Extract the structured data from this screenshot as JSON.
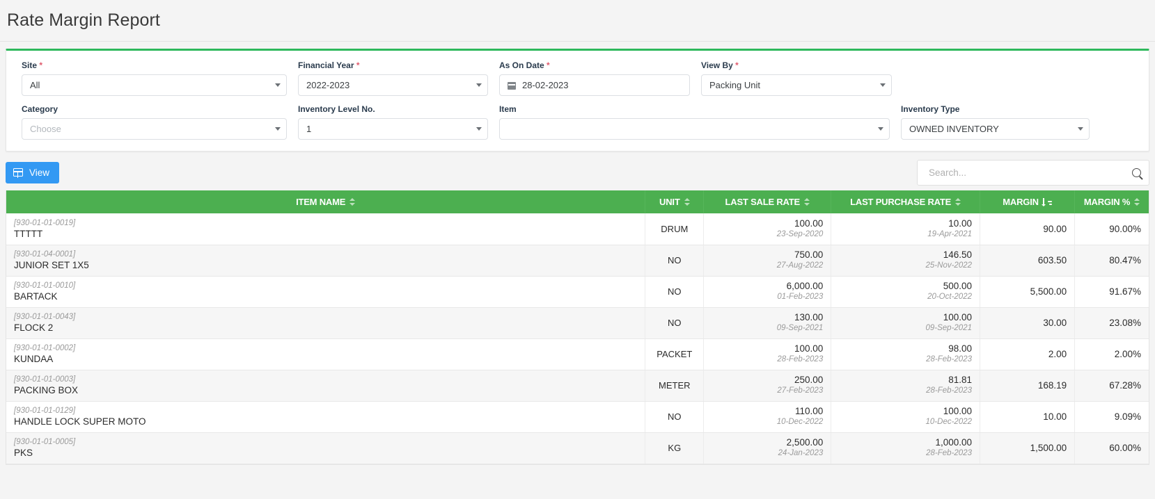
{
  "page": {
    "title": "Rate Margin Report"
  },
  "filters": {
    "site": {
      "label": "Site",
      "required": true,
      "value": "All",
      "placeholder": ""
    },
    "financial_year": {
      "label": "Financial Year",
      "required": true,
      "value": "2022-2023",
      "placeholder": ""
    },
    "as_on_date": {
      "label": "As On Date",
      "required": true,
      "value": "28-02-2023",
      "placeholder": "",
      "icon": "calendar-icon"
    },
    "view_by": {
      "label": "View By",
      "required": true,
      "value": "Packing Unit",
      "placeholder": ""
    },
    "category": {
      "label": "Category",
      "required": false,
      "value": "",
      "placeholder": "Choose"
    },
    "inventory_level": {
      "label": "Inventory Level No.",
      "required": false,
      "value": "1",
      "placeholder": ""
    },
    "item": {
      "label": "Item",
      "required": false,
      "value": "",
      "placeholder": ""
    },
    "inventory_type": {
      "label": "Inventory Type",
      "required": false,
      "value": "OWNED INVENTORY",
      "placeholder": ""
    }
  },
  "toolbar": {
    "view_label": "View",
    "view_icon": "grid-icon",
    "search_placeholder": "Search...",
    "search_value": "",
    "search_icon": "search-icon"
  },
  "table": {
    "columns": [
      {
        "key": "item",
        "label": "ITEM NAME",
        "sort": "sortable"
      },
      {
        "key": "unit",
        "label": "UNIT",
        "sort": "sortable"
      },
      {
        "key": "lsr",
        "label": "LAST SALE RATE",
        "sort": "sortable"
      },
      {
        "key": "lpr",
        "label": "LAST PURCHASE RATE",
        "sort": "sortable"
      },
      {
        "key": "mar",
        "label": "MARGIN",
        "sort": "active-desc"
      },
      {
        "key": "pct",
        "label": "MARGIN %",
        "sort": "sortable"
      }
    ],
    "rows": [
      {
        "code": "[930-01-01-0019]",
        "name": "TTTTT",
        "unit": "DRUM",
        "sale_rate": "100.00",
        "sale_date": "23-Sep-2020",
        "purchase_rate": "10.00",
        "purchase_date": "19-Apr-2021",
        "margin": "90.00",
        "margin_pct": "90.00%"
      },
      {
        "code": "[930-01-04-0001]",
        "name": "JUNIOR SET 1X5",
        "unit": "NO",
        "sale_rate": "750.00",
        "sale_date": "27-Aug-2022",
        "purchase_rate": "146.50",
        "purchase_date": "25-Nov-2022",
        "margin": "603.50",
        "margin_pct": "80.47%"
      },
      {
        "code": "[930-01-01-0010]",
        "name": "BARTACK",
        "unit": "NO",
        "sale_rate": "6,000.00",
        "sale_date": "01-Feb-2023",
        "purchase_rate": "500.00",
        "purchase_date": "20-Oct-2022",
        "margin": "5,500.00",
        "margin_pct": "91.67%"
      },
      {
        "code": "[930-01-01-0043]",
        "name": "FLOCK 2",
        "unit": "NO",
        "sale_rate": "130.00",
        "sale_date": "09-Sep-2021",
        "purchase_rate": "100.00",
        "purchase_date": "09-Sep-2021",
        "margin": "30.00",
        "margin_pct": "23.08%"
      },
      {
        "code": "[930-01-01-0002]",
        "name": "KUNDAA",
        "unit": "PACKET",
        "sale_rate": "100.00",
        "sale_date": "28-Feb-2023",
        "purchase_rate": "98.00",
        "purchase_date": "28-Feb-2023",
        "margin": "2.00",
        "margin_pct": "2.00%"
      },
      {
        "code": "[930-01-01-0003]",
        "name": "PACKING BOX",
        "unit": "METER",
        "sale_rate": "250.00",
        "sale_date": "27-Feb-2023",
        "purchase_rate": "81.81",
        "purchase_date": "28-Feb-2023",
        "margin": "168.19",
        "margin_pct": "67.28%"
      },
      {
        "code": "[930-01-01-0129]",
        "name": "HANDLE LOCK SUPER MOTO",
        "unit": "NO",
        "sale_rate": "110.00",
        "sale_date": "10-Dec-2022",
        "purchase_rate": "100.00",
        "purchase_date": "10-Dec-2022",
        "margin": "10.00",
        "margin_pct": "9.09%"
      },
      {
        "code": "[930-01-01-0005]",
        "name": "PKS",
        "unit": "KG",
        "sale_rate": "2,500.00",
        "sale_date": "24-Jan-2023",
        "purchase_rate": "1,000.00",
        "purchase_date": "28-Feb-2023",
        "margin": "1,500.00",
        "margin_pct": "60.00%"
      }
    ]
  },
  "colors": {
    "header_green": "#4caf50",
    "accent_green": "#2eb85c",
    "primary_blue": "#3399f3",
    "required_red": "#e05c6e",
    "page_bg": "#f4f4f4"
  }
}
